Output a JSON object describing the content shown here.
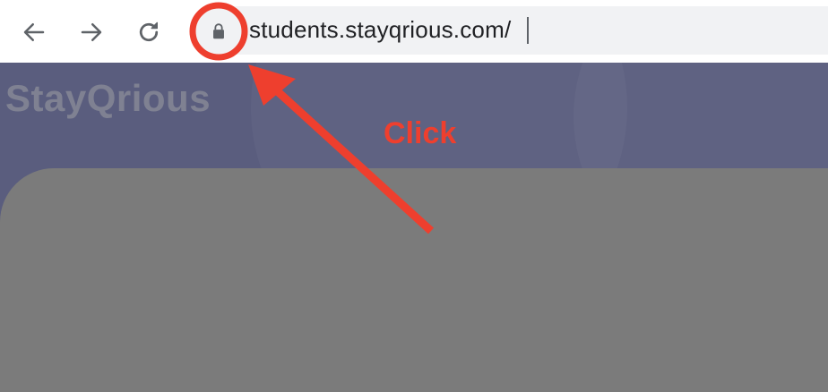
{
  "browser": {
    "back_icon": "arrow-left-icon",
    "forward_icon": "arrow-right-icon",
    "reload_icon": "reload-icon",
    "lock_icon": "lock-icon",
    "url": "students.stayqrious.com/"
  },
  "page": {
    "brand": "StayQrious",
    "background_color": "#5a5d7e",
    "card_color": "#7b7b7b"
  },
  "annotation": {
    "label": "Click",
    "color": "#ee3f2e"
  }
}
